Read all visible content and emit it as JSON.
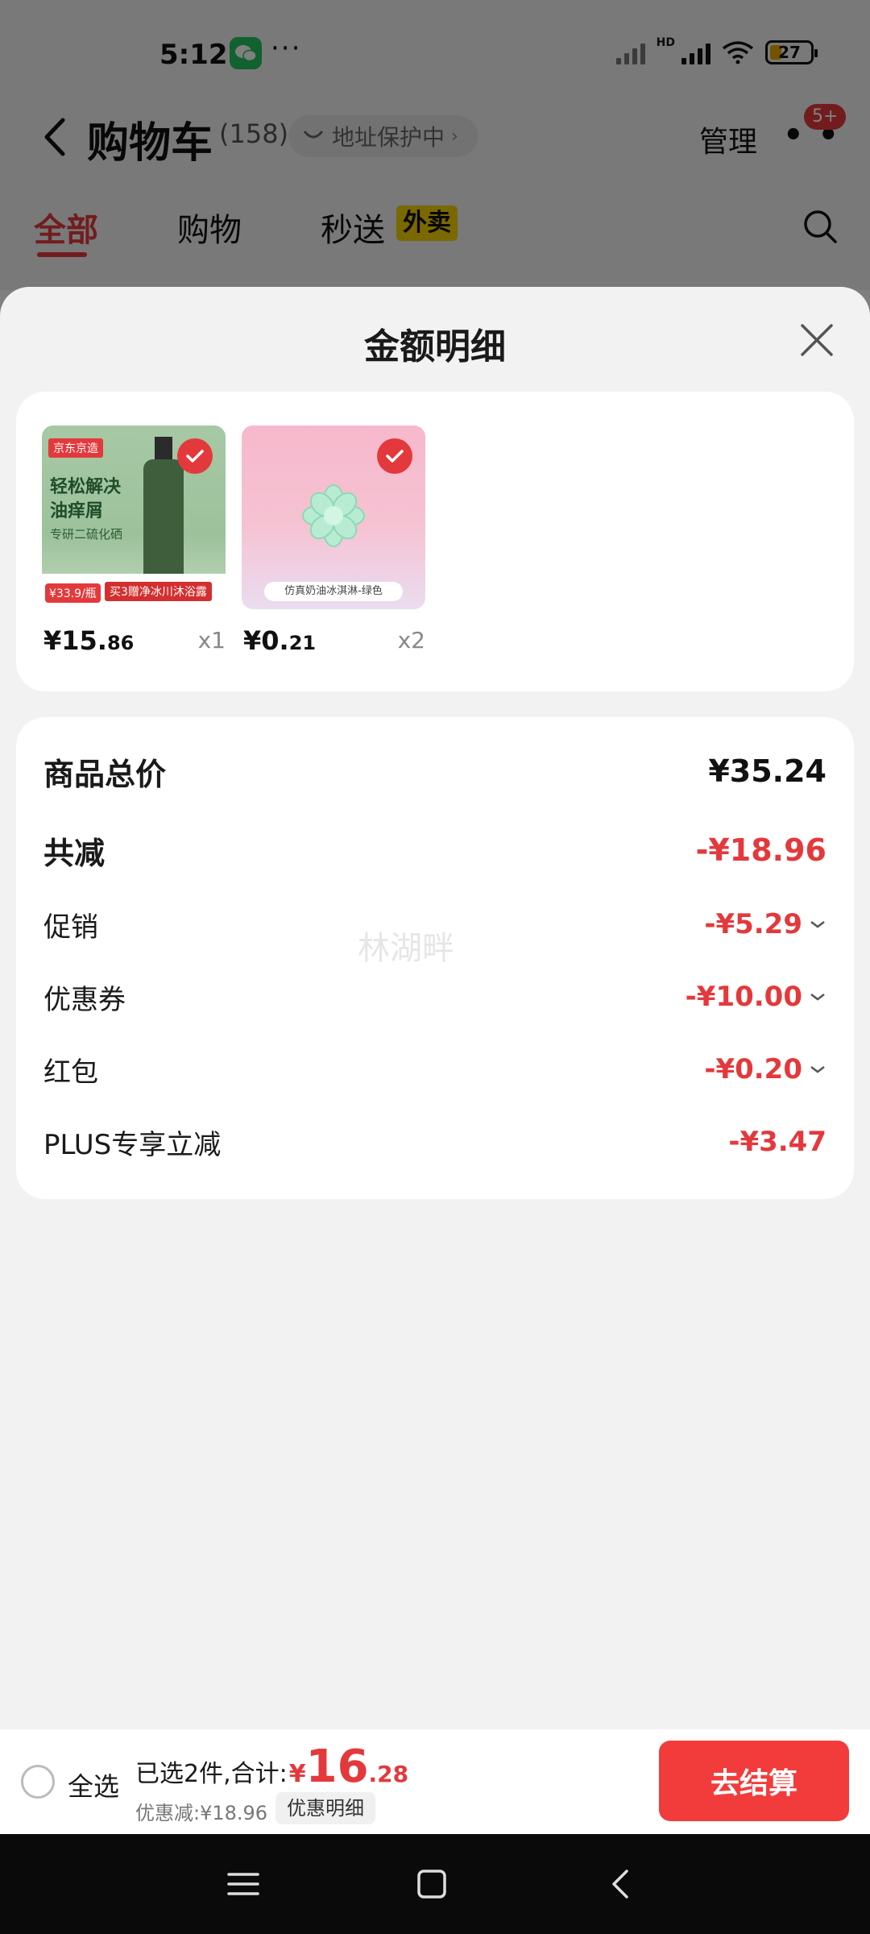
{
  "status_bar": {
    "time": "5:12",
    "battery": "27",
    "icons": [
      "wechat-icon",
      "signal-icon",
      "hd-icon",
      "wifi-icon",
      "battery-icon"
    ]
  },
  "header": {
    "title": "购物车",
    "count": "(158)",
    "address_pill": "地址保护中",
    "manage": "管理",
    "badge": "5+"
  },
  "tabs": [
    {
      "label": "全部",
      "active": true
    },
    {
      "label": "购物",
      "active": false
    },
    {
      "label": "秒送",
      "active": false,
      "tag": "外卖"
    }
  ],
  "sheet": {
    "title": "金额明细",
    "products": [
      {
        "price_int": "¥15.",
        "price_dec": "86",
        "qty": "x1",
        "checked": true,
        "image_text": {
          "brand": "京东京造",
          "line1": "轻松解决",
          "line2": "油痒屑",
          "line3": "专研二硫化硒",
          "promo_price": "¥33.9/瓶",
          "promo": "买3赠净冰川沐浴露"
        }
      },
      {
        "price_int": "¥0.",
        "price_dec": "21",
        "qty": "x2",
        "checked": true,
        "image_text": {
          "label": "仿真奶油冰淇淋-绿色"
        }
      }
    ],
    "summary": {
      "total_label": "商品总价",
      "total_value": "¥35.24",
      "reduce_label": "共减",
      "reduce_value": "-¥18.96",
      "items": [
        {
          "label": "促销",
          "value": "-¥5.29",
          "expandable": true
        },
        {
          "label": "优惠券",
          "value": "-¥10.00",
          "expandable": true
        },
        {
          "label": "红包",
          "value": "-¥0.20",
          "expandable": true
        },
        {
          "label": "PLUS专享立减",
          "value": "-¥3.47",
          "expandable": false
        }
      ],
      "watermark": "林湖畔"
    }
  },
  "action_bar": {
    "select_all": "全选",
    "selected_text": "已选2件,合计:",
    "currency": "¥",
    "total_int": "16",
    "total_dec": ".28",
    "saved_text": "优惠减:¥18.96",
    "detail_button": "优惠明细",
    "checkout_button": "去结算"
  },
  "colors": {
    "accent_red": "#e4393c",
    "checkout_red": "#f23c3c",
    "waimai_yellow": "#f5d000"
  }
}
